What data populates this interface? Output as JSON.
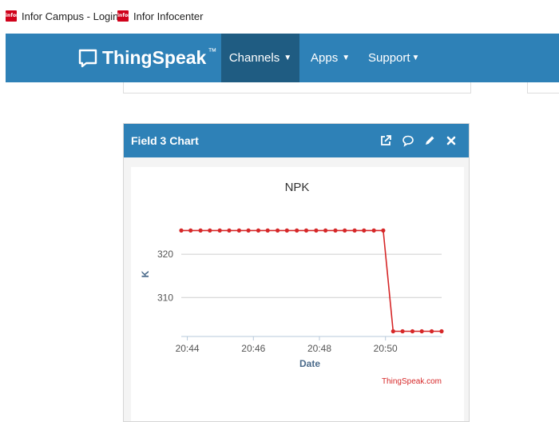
{
  "bookmarks": [
    {
      "label": "Infor Campus - Login",
      "favicon": "infor"
    },
    {
      "label": "Infor Infocenter",
      "favicon": "infor"
    }
  ],
  "navbar": {
    "brand": "ThingSpeak",
    "trademark": "™",
    "items": [
      {
        "label": "Channels",
        "active": true
      },
      {
        "label": "Apps",
        "active": false
      },
      {
        "label": "Support",
        "active": false
      }
    ]
  },
  "panel": {
    "title": "Field 3 Chart",
    "icons": [
      "external-link-icon",
      "comment-icon",
      "pencil-icon",
      "close-icon"
    ]
  },
  "colors": {
    "navbar": "#2e81b7",
    "navbar_active": "#1f5c82",
    "series": "#d62728",
    "attribution": "#d62728",
    "axis_label": "#4a6a8a"
  },
  "chart_data": {
    "type": "line",
    "title": "NPK",
    "xlabel": "Date",
    "ylabel": "K",
    "attribution": "ThingSpeak.com",
    "x_ticks": [
      "20:44",
      "20:46",
      "20:48",
      "20:50"
    ],
    "y_ticks": [
      "310",
      "320"
    ],
    "xlim": [
      "20:43:49",
      "20:51:42"
    ],
    "ylim": [
      301,
      330
    ],
    "grid": true,
    "series": [
      {
        "x": [
          "20:43:49",
          "20:44:06",
          "20:44:24",
          "20:44:41",
          "20:44:59",
          "20:45:16",
          "20:45:34",
          "20:45:51",
          "20:46:09",
          "20:46:26",
          "20:46:44",
          "20:47:01",
          "20:47:19",
          "20:47:36",
          "20:47:54",
          "20:48:11",
          "20:48:29",
          "20:48:46",
          "20:49:04",
          "20:49:21",
          "20:49:39",
          "20:49:56",
          "20:50:14",
          "20:50:31",
          "20:50:49",
          "20:51:06",
          "20:51:24",
          "20:51:42"
        ],
        "y": [
          325.5,
          325.5,
          325.5,
          325.5,
          325.5,
          325.5,
          325.5,
          325.5,
          325.5,
          325.5,
          325.5,
          325.5,
          325.5,
          325.5,
          325.5,
          325.5,
          325.5,
          325.5,
          325.5,
          325.5,
          325.5,
          325.5,
          302.2,
          302.2,
          302.2,
          302.2,
          302.2,
          302.2
        ]
      }
    ]
  }
}
